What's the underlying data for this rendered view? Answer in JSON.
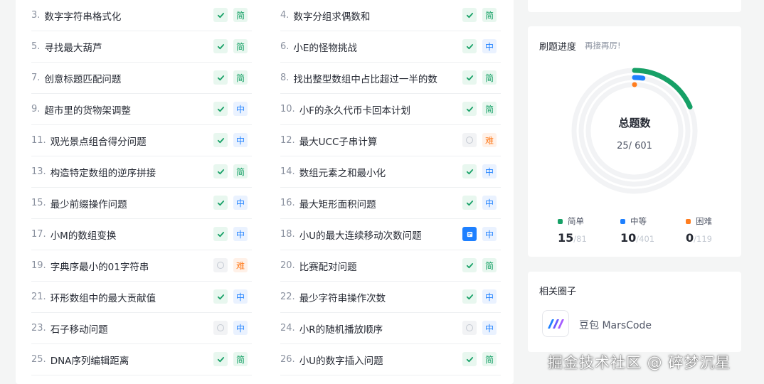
{
  "problems": [
    {
      "num": "3.",
      "title": "数字字符串格式化",
      "status": "done",
      "difficulty": "简",
      "level": "easy"
    },
    {
      "num": "4.",
      "title": "数字分组求偶数和",
      "status": "done",
      "difficulty": "简",
      "level": "easy"
    },
    {
      "num": "5.",
      "title": "寻找最大葫芦",
      "status": "done",
      "difficulty": "简",
      "level": "easy"
    },
    {
      "num": "6.",
      "title": "小E的怪物挑战",
      "status": "done",
      "difficulty": "中",
      "level": "medium"
    },
    {
      "num": "7.",
      "title": "创意标题匹配问题",
      "status": "done",
      "difficulty": "简",
      "level": "easy"
    },
    {
      "num": "8.",
      "title": "找出整型数组中占比超过一半的数",
      "status": "done",
      "difficulty": "简",
      "level": "easy"
    },
    {
      "num": "9.",
      "title": "超市里的货物架调整",
      "status": "done",
      "difficulty": "中",
      "level": "medium"
    },
    {
      "num": "10.",
      "title": "小F的永久代币卡回本计划",
      "status": "done",
      "difficulty": "简",
      "level": "easy"
    },
    {
      "num": "11.",
      "title": "观光景点组合得分问题",
      "status": "done",
      "difficulty": "中",
      "level": "medium"
    },
    {
      "num": "12.",
      "title": "最大UCC子串计算",
      "status": "todo",
      "difficulty": "难",
      "level": "hard"
    },
    {
      "num": "13.",
      "title": "构造特定数组的逆序拼接",
      "status": "done",
      "difficulty": "简",
      "level": "easy"
    },
    {
      "num": "14.",
      "title": "数组元素之和最小化",
      "status": "done",
      "difficulty": "中",
      "level": "medium"
    },
    {
      "num": "15.",
      "title": "最少前缀操作问题",
      "status": "done",
      "difficulty": "中",
      "level": "medium"
    },
    {
      "num": "16.",
      "title": "最大矩形面积问题",
      "status": "done",
      "difficulty": "中",
      "level": "medium"
    },
    {
      "num": "17.",
      "title": "小M的数组变换",
      "status": "done",
      "difficulty": "中",
      "level": "medium"
    },
    {
      "num": "18.",
      "title": "小U的最大连续移动次数问题",
      "status": "trying",
      "difficulty": "中",
      "level": "medium"
    },
    {
      "num": "19.",
      "title": "字典序最小的01字符串",
      "status": "todo",
      "difficulty": "难",
      "level": "hard"
    },
    {
      "num": "20.",
      "title": "比赛配对问题",
      "status": "done",
      "difficulty": "简",
      "level": "easy"
    },
    {
      "num": "21.",
      "title": "环形数组中的最大贡献值",
      "status": "done",
      "difficulty": "中",
      "level": "medium"
    },
    {
      "num": "22.",
      "title": "最少字符串操作次数",
      "status": "done",
      "difficulty": "中",
      "level": "medium"
    },
    {
      "num": "23.",
      "title": "石子移动问题",
      "status": "todo",
      "difficulty": "中",
      "level": "medium"
    },
    {
      "num": "24.",
      "title": "小R的随机播放顺序",
      "status": "todo",
      "difficulty": "中",
      "level": "medium"
    },
    {
      "num": "25.",
      "title": "DNA序列编辑距离",
      "status": "done",
      "difficulty": "简",
      "level": "easy"
    },
    {
      "num": "26.",
      "title": "小U的数字插入问题",
      "status": "done",
      "difficulty": "简",
      "level": "easy"
    }
  ],
  "progress": {
    "title": "刷题进度",
    "subtitle": "再接再厉!",
    "center_title": "总题数",
    "solved": "25",
    "total": "601",
    "count_text": "25/ 601",
    "stats": [
      {
        "label": "简单",
        "solved": "15",
        "total": "/81",
        "color": "#16a066"
      },
      {
        "label": "中等",
        "solved": "10",
        "total": "/401",
        "color": "#1e80ff"
      },
      {
        "label": "困难",
        "solved": "0",
        "total": "/119",
        "color": "#ff7d1f"
      }
    ],
    "ring_fractions": {
      "easy": 0.185,
      "medium": 0.025,
      "hard": 0.0
    }
  },
  "circle": {
    "title": "相关圈子",
    "name": "豆包 MarsCode"
  },
  "watermark": "掘金技术社区 @ 碎梦沉星",
  "colors": {
    "easy": "#16a066",
    "medium": "#1e80ff",
    "hard": "#ff7d1f",
    "ring_track": "#f2f3f5"
  }
}
